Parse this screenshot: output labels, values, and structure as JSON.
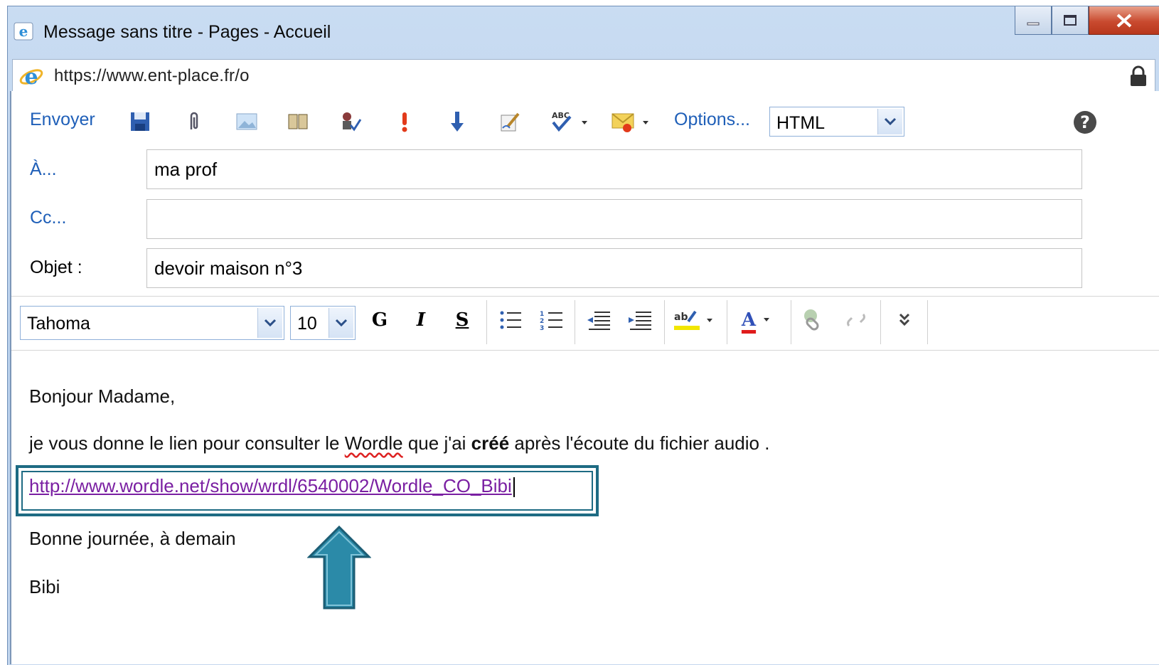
{
  "window": {
    "title": "Message sans titre - Pages - Accueil",
    "url": "https://www.ent-place.fr/o",
    "controls": {
      "minimize": "minimize",
      "maximize": "maximize",
      "close": "close"
    }
  },
  "toolbar": {
    "send_label": "Envoyer",
    "options_label": "Options...",
    "format_value": "HTML",
    "icons": [
      "save-icon",
      "attach-icon",
      "image-icon",
      "address-book-icon",
      "check-names-icon",
      "high-importance-icon",
      "low-importance-icon",
      "signature-icon",
      "spellcheck-icon",
      "message-flag-icon",
      "help-icon"
    ]
  },
  "fields": {
    "to_label": "À...",
    "to_value": "ma prof",
    "cc_label": "Cc...",
    "cc_value": "",
    "subject_label": "Objet :",
    "subject_value": "devoir maison n°3"
  },
  "formatting": {
    "font_name": "Tahoma",
    "font_size": "10",
    "bold": "G",
    "italic": "I",
    "strike": "S",
    "font_color_glyph": "A",
    "colors": {
      "highlight": "#f2e600",
      "font_color": "#e01b1b"
    }
  },
  "body": {
    "greeting": "Bonjour Madame,",
    "sentence_before": "je vous donne le lien pour consulter le ",
    "sentence_word": "Wordle",
    "sentence_middle": " que j'ai ",
    "sentence_bold": "créé",
    "sentence_after": " après l'écoute du fichier audio .",
    "link": "http://www.wordle.net/show/wrdl/6540002/Wordle_CO_Bibi",
    "closing": "Bonne journée, à demain",
    "signature": "Bibi"
  },
  "colors": {
    "accent_link": "#1f5fb8",
    "visited_link": "#7a1fa2",
    "highlight_frame": "#1e6b83",
    "arrow_fill": "#2b8aa8"
  }
}
